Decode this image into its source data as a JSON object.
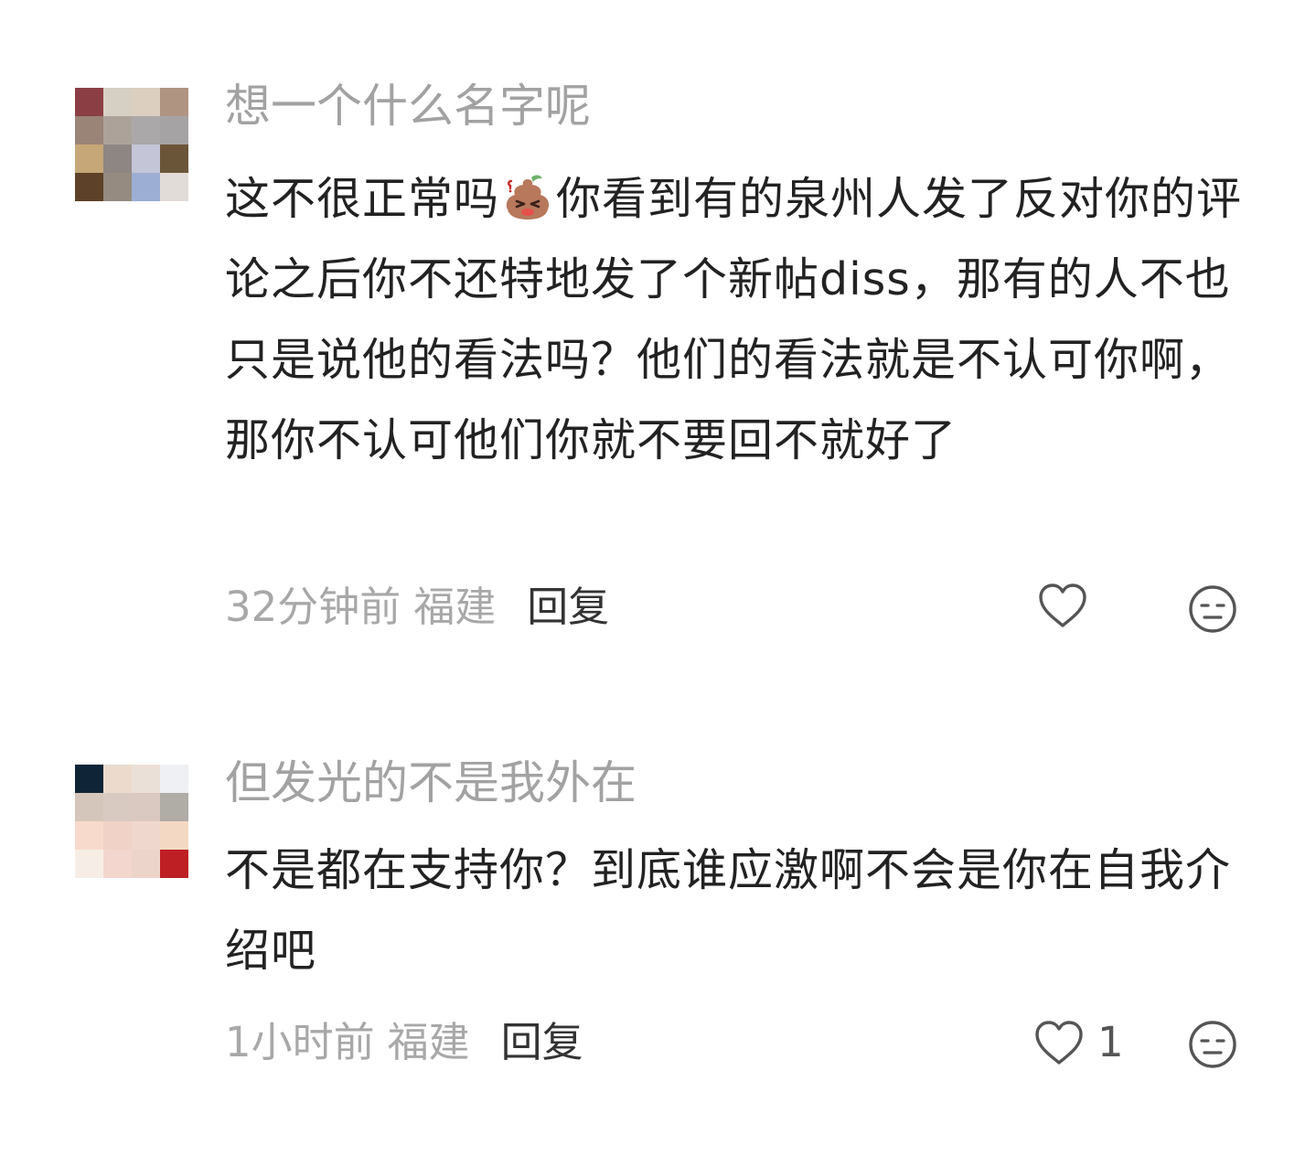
{
  "comments": [
    {
      "username": "想一个什么名字呢",
      "text_before_emoji": "这不很正常吗",
      "emoji_icon": "sweating-poop-emoji-icon",
      "text_after_emoji": "你看到有的泉州人发了反对你的评论之后你不还特地发了个新帖diss，那有的人不也只是说他的看法吗？他们的看法就是不认可你啊，那你不认可他们你就不要回不就好了",
      "time": "32分钟前",
      "location": "福建",
      "reply_label": "回复",
      "like_count": "",
      "avatar_colors": [
        "#8b3f45",
        "#d6d0c4",
        "#dccfc0",
        "#b09482",
        "#9a8478",
        "#ada29a",
        "#aaa8a8",
        "#a6a3a5",
        "#c6a777",
        "#8d8683",
        "#c4c5d6",
        "#6b5538",
        "#5d4128",
        "#958b80",
        "#9caed3",
        "#e2dcd8"
      ]
    },
    {
      "username": "但发光的不是我外在",
      "text_before_emoji": "不是都在支持你？到底谁应激啊不会是你在自我介绍吧",
      "emoji_icon": "",
      "text_after_emoji": "",
      "time": "1小时前",
      "location": "福建",
      "reply_label": "回复",
      "like_count": "1",
      "avatar_colors": [
        "#0f2437",
        "#ecdbcd",
        "#ebe0d8",
        "#eef0f3",
        "#d5c6bb",
        "#d9cac1",
        "#dac9c0",
        "#b0aca6",
        "#f7dacb",
        "#f1d2c6",
        "#efd7cd",
        "#f3d9c3",
        "#f6eee6",
        "#f3d6ce",
        "#ecd4ca",
        "#be1f24"
      ]
    }
  ],
  "icons": {
    "like": "heart-outline-icon",
    "dislike": "neutral-face-icon"
  },
  "colors": {
    "username": "#a2a2a2",
    "meta": "#a8a8a8",
    "text": "#222222",
    "icon": "#555555"
  }
}
